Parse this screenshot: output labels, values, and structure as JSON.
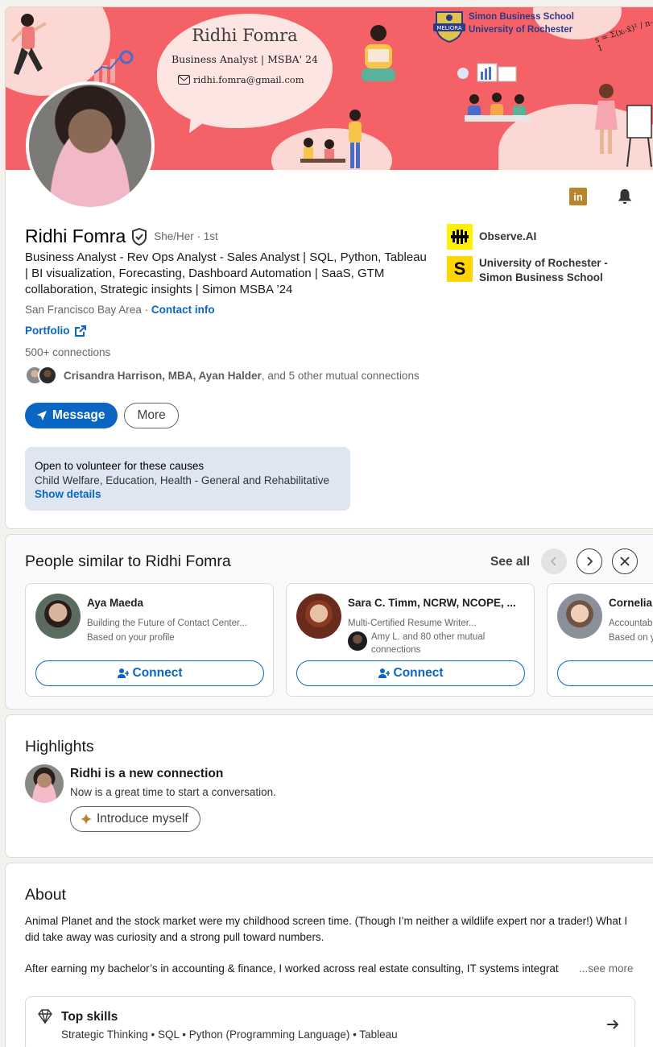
{
  "banner": {
    "name": "Ridhi Fomra",
    "role": "Business Analyst | MSBA' 24",
    "email": "ridhi.fomra@gmail.com",
    "school_line1": "Simon Business School",
    "school_line2": "University of Rochester",
    "formula": "s = Σ(xᵢ-x̄)² / n-1"
  },
  "profile": {
    "name": "Ridhi Fomra",
    "pronouns": "She/Her · 1st",
    "headline": "Business Analyst - Rev Ops Analyst - Sales Analyst | SQL, Python, Tableau | BI visualization, Forecasting, Dashboard Automation | SaaS, GTM collaboration, Strategic insights | Simon MSBA ’24",
    "location": "San Francisco Bay Area · ",
    "contact_info": "Contact info",
    "portfolio": "Portfolio",
    "connections": "500+ connections",
    "mutual_names": "Crisandra Harrison, MBA, Ayan Halder",
    "mutual_rest": ", and 5 other mutual connections",
    "message_label": "Message",
    "more_label": "More",
    "volunteer_title": "Open to volunteer for these causes",
    "volunteer_causes": "Child Welfare, Education, Health - General and Rehabilitative",
    "volunteer_show": "Show details",
    "orgs": [
      {
        "name": "Observe.AI"
      },
      {
        "name": "University of Rochester - Simon Business School",
        "logo_letter": "S"
      }
    ]
  },
  "similar": {
    "title": "People similar to Ridhi Fomra",
    "see_all": "See all",
    "people": [
      {
        "name": "Aya Maeda",
        "sub1": "Building the Future of Contact Center...",
        "sub2": "Based on your profile",
        "connect": "Connect"
      },
      {
        "name": "Sara C. Timm, NCRW, NCOPE, ...",
        "sub1": "Multi-Certified Resume Writer...",
        "mutual": "Amy L. and 80 other mutual connections",
        "connect": "Connect"
      },
      {
        "name": "Cornelia",
        "sub1": "Accountab",
        "sub2": "Based on y",
        "connect": ""
      }
    ]
  },
  "highlights": {
    "title": "Highlights",
    "item_title": "Ridhi is a new connection",
    "item_sub": "Now is a great time to start a conversation.",
    "button": "Introduce myself"
  },
  "about": {
    "title": "About",
    "para1": "Animal Planet and the stock market were my childhood screen time. (Though I’m neither a wildlife expert nor a trader!) What I did take away was curiosity and a strong pull toward numbers.",
    "para2": "After earning my bachelor’s in accounting & finance, I worked across real estate consulting, IT systems integrat",
    "see_more": "...see more",
    "skills_title": "Top skills",
    "skills_list": "Strategic Thinking • SQL • Python (Programming Language) • Tableau"
  },
  "colors": {
    "brand_blue": "#0a66c2",
    "banner_coral": "#f46167",
    "linkedin_badge": "#b8842c"
  }
}
